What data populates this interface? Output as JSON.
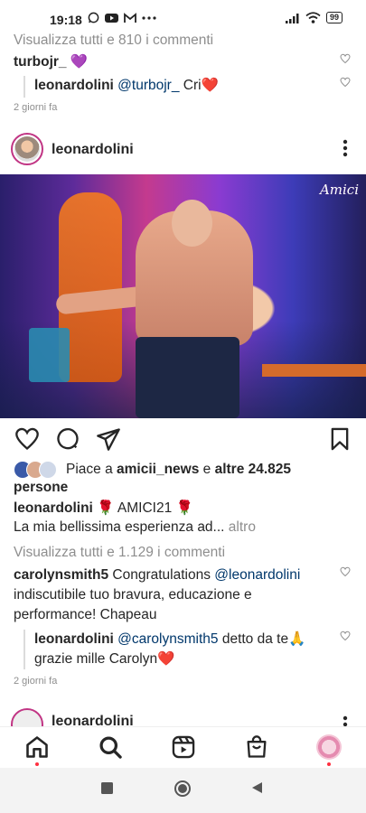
{
  "status_bar": {
    "time": "19:18",
    "app_icons": [
      "whatsapp-icon",
      "youtube-icon",
      "gmail-icon",
      "more-dots-icon"
    ],
    "right_icons": [
      "signal-icon",
      "wifi-icon"
    ],
    "battery": "99"
  },
  "prev_post": {
    "view_all_comments": "Visualizza tutti e 810 i commenti",
    "comment": {
      "user": "turbojr_",
      "text": "💜"
    },
    "reply": {
      "user": "leonardolini",
      "mention": "@turbojr_",
      "text": " Cri❤️"
    },
    "time": "2 giorni fa"
  },
  "post": {
    "username": "leonardolini",
    "image_watermark": "Amici",
    "likes": {
      "prefix": "Piace a ",
      "user": "amicii_news",
      "middle": " e ",
      "count": "altre 24.825",
      "line2": "persone"
    },
    "caption": {
      "user": "leonardolini",
      "text": " 🌹 AMICI21 🌹",
      "line2": "La mia bellissima esperienza ad...",
      "more": " altro"
    },
    "view_all_comments": "Visualizza tutti e 1.129 i commenti",
    "comment": {
      "user": "carolynsmith5",
      "mention": "@leonardolini",
      "text_before": " Congratulations ",
      "text_after": " indiscutibile tuo bravura, educazione e performance! Chapeau"
    },
    "reply": {
      "user": "leonardolini",
      "mention": "@carolynsmith5",
      "text": " detto da te🙏 grazie mille Carolyn❤️"
    },
    "time": "2 giorni fa"
  },
  "next_post": {
    "username": "leonardolini"
  },
  "bottom_nav": [
    "home-icon",
    "search-icon",
    "reels-icon",
    "shop-icon",
    "profile-icon"
  ],
  "colors": {
    "link": "#00376b",
    "muted": "#8e8e8e",
    "heart": "#ed4956",
    "notify_dot": "#ff3040"
  }
}
